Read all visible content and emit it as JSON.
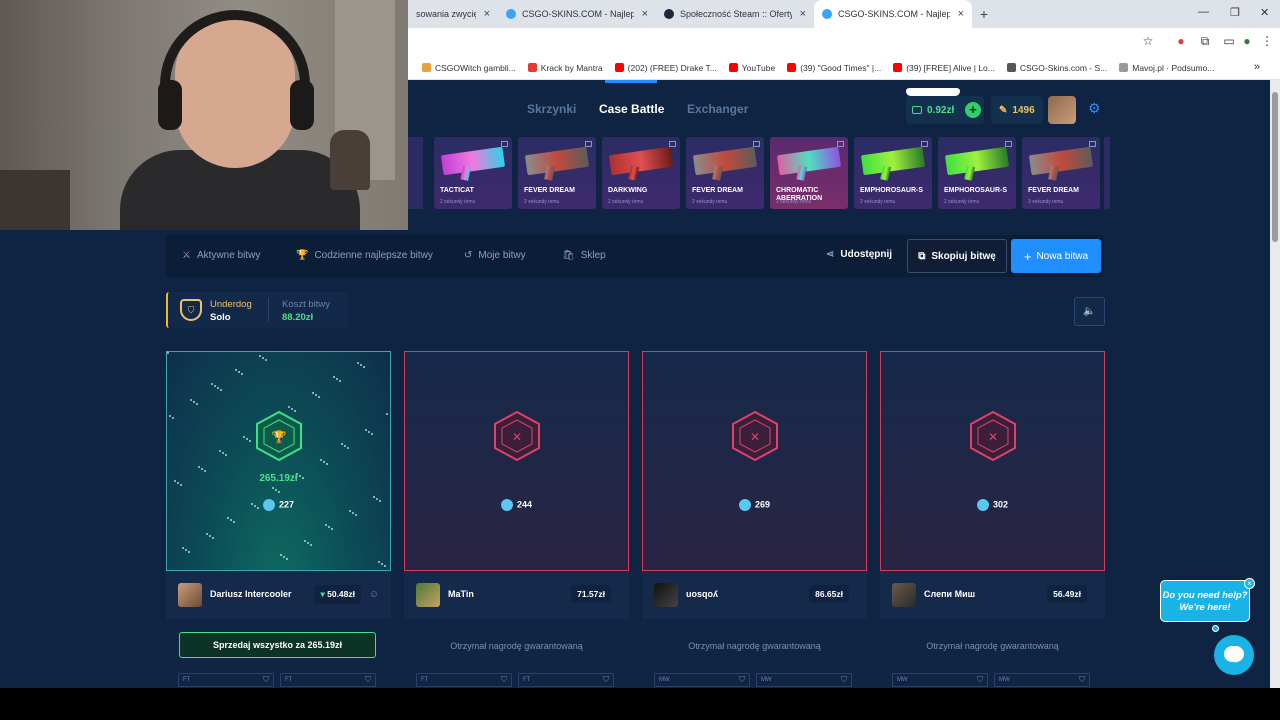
{
  "browser": {
    "tabs": [
      {
        "label": "sowania zwycięzcy",
        "fav": "#bbb",
        "active": false
      },
      {
        "label": "CSGO-SKINS.COM - Najlepsze",
        "fav": "#37a4ff",
        "active": false
      },
      {
        "label": "Społeczność Steam :: Oferty wy",
        "fav": "#1b2838",
        "active": false
      },
      {
        "label": "CSGO-SKINS.COM - Najlepsze",
        "fav": "#37a4ff",
        "active": true
      }
    ],
    "new_tab": "+",
    "bookmarks": [
      {
        "label": "CSGOWitch gambli...",
        "color": "#e6a23c"
      },
      {
        "label": "Krack by Mantra",
        "color": "#e53935"
      },
      {
        "label": "(202) (FREE) Drake T...",
        "color": "#ff0000"
      },
      {
        "label": "YouTube",
        "color": "#ff0000"
      },
      {
        "label": "(39) \"Good Times\" |...",
        "color": "#ff0000"
      },
      {
        "label": "(39) [FREE] Alive | Lo...",
        "color": "#ff0000"
      },
      {
        "label": "CSGO-Skins.com - S...",
        "color": "#555"
      },
      {
        "label": "Mavoj.pl · Podsumo...",
        "color": "#999"
      }
    ],
    "bookmarks_more": "»"
  },
  "header": {
    "nav": [
      "Skrzynki",
      "Case Battle",
      "Exchanger"
    ],
    "active_nav": "Case Battle",
    "balance": "0.92zł",
    "tokens": "1496",
    "colors": {
      "bg": "#0f2342",
      "accent": "#1f8fff",
      "green": "#48e08a"
    }
  },
  "ticker": [
    {
      "name": "TACTICAT",
      "sub": "2 sekundy temu",
      "gun": "linear-gradient(90deg,#c43fd8,#f07be0,#2cd2e8)",
      "pink": false
    },
    {
      "name": "FEVER DREAM",
      "sub": "2 sekundy temu",
      "gun": "linear-gradient(90deg,#8c8c8c,#c14a3c,#5c5c5c)",
      "pink": false
    },
    {
      "name": "DARKWING",
      "sub": "2 sekundy temu",
      "gun": "linear-gradient(90deg,#b03030,#e05050,#6c1c1c)",
      "pink": false
    },
    {
      "name": "FEVER DREAM",
      "sub": "2 sekundy temu",
      "gun": "linear-gradient(90deg,#8c8c8c,#c14a3c,#5c5c5c)",
      "pink": false
    },
    {
      "name": "CHROMATIC ABERRATION",
      "sub": "2 sekundy temu",
      "gun": "linear-gradient(90deg,#e060a0,#50e0c0,#9050e0)",
      "pink": true
    },
    {
      "name": "EMPHOROSAUR-S",
      "sub": "2 sekundy temu",
      "gun": "linear-gradient(90deg,#40e040,#a0f040,#2a7a2a)",
      "pink": false
    },
    {
      "name": "EMPHOROSAUR-S",
      "sub": "2 sekundy temu",
      "gun": "linear-gradient(90deg,#40e040,#a0f040,#2a7a2a)",
      "pink": false
    },
    {
      "name": "FEVER DREAM",
      "sub": "3 sekundy temu",
      "gun": "linear-gradient(90deg,#8c8c8c,#c14a3c,#5c5c5c)",
      "pink": false
    }
  ],
  "battle_nav": {
    "items": [
      {
        "label": "Aktywne bitwy",
        "icon": "⚔"
      },
      {
        "label": "Codzienne najlepsze bitwy",
        "icon": "🏆"
      },
      {
        "label": "Moje bitwy",
        "icon": "↺"
      },
      {
        "label": "Sklep",
        "icon": "🛍"
      }
    ],
    "share": "Udostępnij",
    "copy": "Skopiuj bitwę",
    "new": "Nowa bitwa",
    "new_prefix": "+"
  },
  "mode": {
    "name": "Underdog",
    "type": "Solo",
    "cost_label": "Koszt bitwy",
    "cost_value": "88.20zł"
  },
  "players": [
    {
      "name": "Dariusz Intercooler",
      "value": "50.48zł",
      "coins": "227",
      "win": true,
      "win_amount": "265.19zł",
      "avatar": "linear-gradient(135deg,#c99d7a,#6b4a36)",
      "action": "Sprzedaj wszystko za 265.19zł",
      "chips": [
        "FT",
        "FT"
      ]
    },
    {
      "name": "MaTin",
      "value": "71.57zł",
      "coins": "244",
      "win": false,
      "avatar": "linear-gradient(135deg,#4a7a3a,#c9a060)",
      "action": "Otrzymał nagrodę gwarantowaną",
      "chips": [
        "FT",
        "FT"
      ]
    },
    {
      "name": "uosqoʎ",
      "value": "86.65zł",
      "coins": "269",
      "win": false,
      "avatar": "linear-gradient(135deg,#111,#444)",
      "action": "Otrzymał nagrodę gwarantowaną",
      "chips": [
        "MW",
        "MW"
      ]
    },
    {
      "name": "Слепи Миш",
      "value": "56.49zł",
      "coins": "302",
      "win": false,
      "avatar": "linear-gradient(135deg,#6a5a4a,#2a2a2a)",
      "action": "Otrzymał nagrodę gwarantowaną",
      "chips": [
        "MW",
        "MW"
      ]
    }
  ],
  "chat": {
    "bubble": "Do you need help? We're here!",
    "close": "×"
  }
}
